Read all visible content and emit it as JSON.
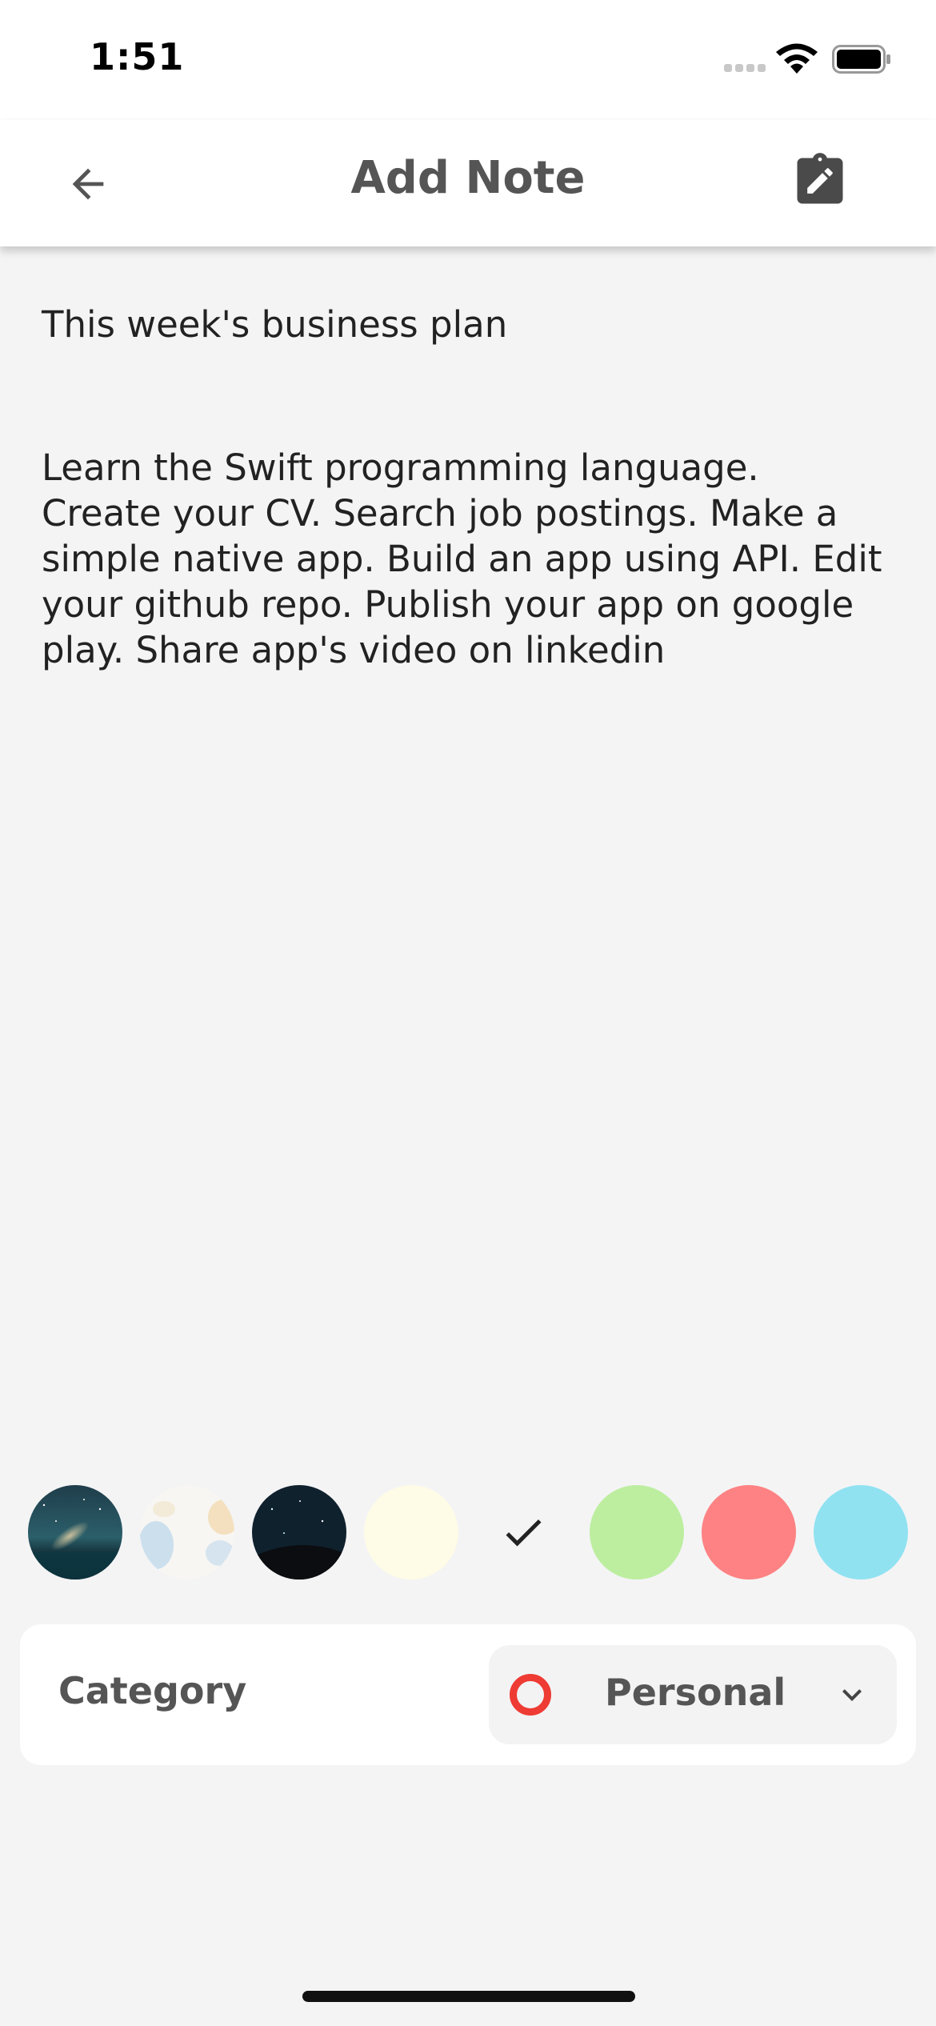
{
  "status_bar": {
    "time": "1:51"
  },
  "header": {
    "title": "Add Note",
    "back_icon": "arrow-left-icon",
    "save_icon": "clipboard-edit-icon"
  },
  "note": {
    "title": "This week's business plan",
    "body": "Learn the Swift programming language. Create your CV. Search job postings. Make a simple native app. Build an app using API. Edit your github repo. Publish your app on google play. Share app's video on linkedin"
  },
  "colors": {
    "swatches": [
      {
        "kind": "image",
        "name": "galaxy-image"
      },
      {
        "kind": "image",
        "name": "watercolor-image"
      },
      {
        "kind": "image",
        "name": "night-sky-image"
      },
      {
        "kind": "color",
        "value": "#fefbe6"
      },
      {
        "kind": "selected",
        "value": "#f4f4f5"
      },
      {
        "kind": "color",
        "value": "#bdeea0"
      },
      {
        "kind": "color",
        "value": "#fe8283"
      },
      {
        "kind": "color",
        "value": "#90e2f1"
      }
    ]
  },
  "category": {
    "label": "Category",
    "selected": "Personal",
    "dot_color": "#ee3b33"
  }
}
